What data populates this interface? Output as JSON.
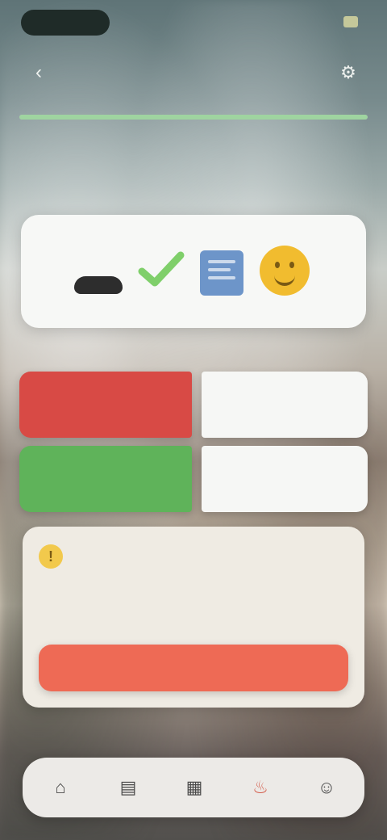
{
  "status_bar": {
    "time": "",
    "indicator_color": "#c5c89a"
  },
  "nav": {
    "title": "",
    "back_icon": "chevron-left-icon",
    "settings_icon": "gear-icon"
  },
  "progress": {
    "value_percent": 100,
    "color": "#9fd4a0"
  },
  "section": {
    "caption": ""
  },
  "icon_card": {
    "icons": [
      "shoe-icon",
      "checkmark-icon",
      "document-icon",
      "smiley-face-icon"
    ]
  },
  "choices": [
    {
      "left_label": "",
      "left_color": "#d84a45",
      "right_label": ""
    },
    {
      "left_label": "",
      "left_color": "#5fb35a",
      "right_label": ""
    }
  ],
  "alert": {
    "icon": "warning-icon",
    "title": "",
    "body": "",
    "button_label": "",
    "button_color": "#ee6a55"
  },
  "tabbar": {
    "tabs": [
      {
        "icon": "home-icon",
        "active": false
      },
      {
        "icon": "book-icon",
        "active": false
      },
      {
        "icon": "chart-icon",
        "active": false
      },
      {
        "icon": "flame-icon",
        "active": true
      },
      {
        "icon": "profile-icon",
        "active": false
      }
    ],
    "active_color": "#d45c4b"
  }
}
